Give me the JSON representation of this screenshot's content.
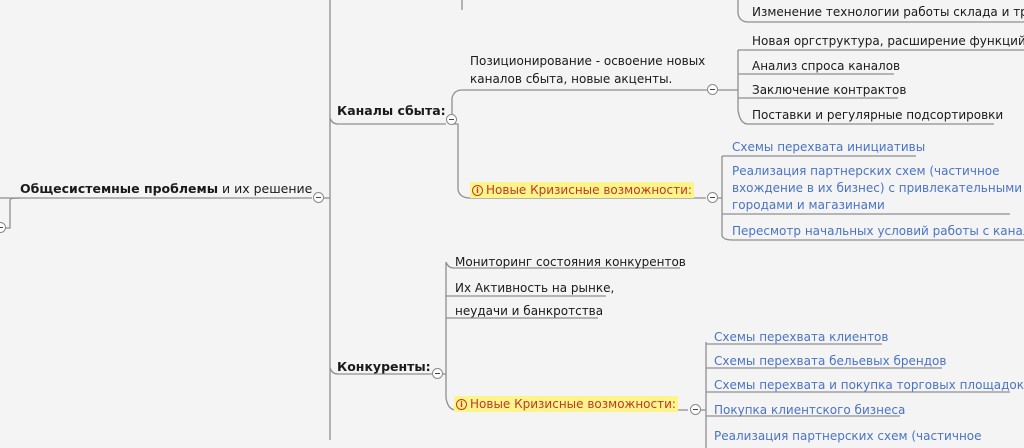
{
  "root": {
    "label_bold": "Общесистемные проблемы",
    "label_rest": " и их решение"
  },
  "channels": {
    "label": "Каналы сбыта:",
    "top_item": "Изменение технологии работы склада и тран",
    "positioning": {
      "line1": "Позиционирование - освоение новых",
      "line2": "каналов сбыта, новые акценты."
    },
    "items": [
      "Новая оргструктура, расширение функций де",
      "Анализ спроса каналов",
      "Заключение контрактов",
      "Поставки и регулярные подсортировки"
    ],
    "crisis_label": "Новые Кризисные возможности:",
    "crisis_items": [
      "Схемы перехвата инициативы",
      "Реализация партнерских схем (частичное",
      "вхождение в их бизнес) с привлекательными",
      "городами и магазинами",
      "Пересмотр начальных условий работы с каналам"
    ]
  },
  "competitors": {
    "label": "Конкуренты:",
    "items": [
      "Мониторинг состояния конкурентов",
      "Их Активность на рынке,",
      "неудачи и банкротства"
    ],
    "crisis_label": "Новые Кризисные возможности:",
    "crisis_items": [
      "Схемы перехвата клиентов",
      "Схемы перехвата бельевых брендов",
      "Схемы перехвата и покупка торговых площадок",
      "Покупка клиентского бизнеса",
      "Реализация партнерских схем (частичное"
    ]
  },
  "colors": {
    "link": "#4a73c6",
    "highlight": "#fdf48a",
    "crisis_text": "#c0392b",
    "connector": "#8f8f8f"
  }
}
